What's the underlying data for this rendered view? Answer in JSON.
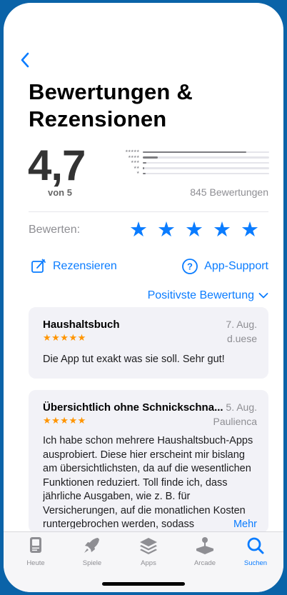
{
  "nav": {
    "back_icon": "chevron-left-icon"
  },
  "page_title": "Bewertungen & Rezensionen",
  "summary": {
    "average": "4,7",
    "out_of": "von 5",
    "count_text": "845 Bewertungen",
    "distribution": [
      {
        "stars": 5,
        "fraction": 0.82
      },
      {
        "stars": 4,
        "fraction": 0.12
      },
      {
        "stars": 3,
        "fraction": 0.03
      },
      {
        "stars": 2,
        "fraction": 0.01
      },
      {
        "stars": 1,
        "fraction": 0.02
      }
    ]
  },
  "rate": {
    "label": "Bewerten:",
    "star_count": 5
  },
  "actions": {
    "review_label": "Rezensieren",
    "support_label": "App-Support"
  },
  "sort": {
    "label": "Positivste Bewertung"
  },
  "reviews": [
    {
      "title": "Haushaltsbuch",
      "date": "7. Aug.",
      "author": "d.uese",
      "stars": "★★★★★",
      "body": "Die App tut exakt was sie soll. Sehr gut!"
    },
    {
      "title": "Übersichtlich ohne Schnickschna...",
      "date": "5. Aug.",
      "author": "Paulienca",
      "stars": "★★★★★",
      "body": "Ich habe schon mehrere Haushaltsbuch-Apps ausprobiert. Diese hier erscheint mir bislang am übersichtlichsten, da auf die wesentlichen Funktionen reduziert. Toll finde ich, dass jährliche Ausgaben, wie z. B. für Versicherungen, auf die monatlichen Kosten runtergebrochen werden, sodass",
      "more_label": "Mehr"
    }
  ],
  "tabs": [
    {
      "label": "Heute",
      "icon": "today-icon"
    },
    {
      "label": "Spiele",
      "icon": "rocket-icon"
    },
    {
      "label": "Apps",
      "icon": "apps-stack-icon"
    },
    {
      "label": "Arcade",
      "icon": "joystick-icon"
    },
    {
      "label": "Suchen",
      "icon": "search-icon",
      "active": true
    }
  ],
  "colors": {
    "accent": "#0a7cff",
    "star_orange": "#ff9500",
    "background": "#0a63a8"
  }
}
